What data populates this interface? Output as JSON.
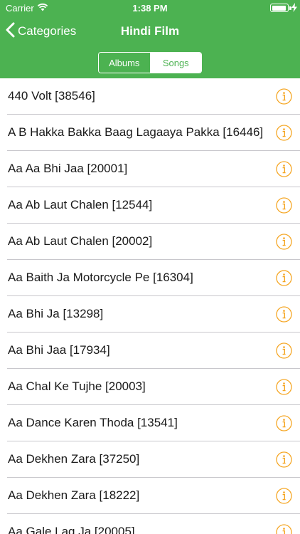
{
  "status_bar": {
    "carrier": "Carrier",
    "time": "1:38 PM",
    "wifi_icon": "wifi-icon",
    "battery_icon": "battery-icon",
    "charging_icon": "charging-bolt-icon"
  },
  "nav": {
    "back_label": "Categories",
    "title": "Hindi Film"
  },
  "segments": {
    "albums_label": "Albums",
    "songs_label": "Songs",
    "selected": "Songs"
  },
  "colors": {
    "accent": "#4cb251",
    "info_icon": "#f5a623",
    "separator": "#c8c7cc"
  },
  "songs": [
    {
      "title": "440 Volt [38546]"
    },
    {
      "title": "A B Hakka Bakka Baag Lagaaya Pakka [16446]"
    },
    {
      "title": "Aa Aa Bhi Jaa [20001]"
    },
    {
      "title": "Aa Ab Laut Chalen [12544]"
    },
    {
      "title": "Aa Ab Laut Chalen [20002]"
    },
    {
      "title": "Aa Baith Ja Motorcycle Pe [16304]"
    },
    {
      "title": "Aa Bhi Ja [13298]"
    },
    {
      "title": "Aa Bhi Jaa [17934]"
    },
    {
      "title": "Aa Chal Ke Tujhe [20003]"
    },
    {
      "title": "Aa Dance Karen Thoda [13541]"
    },
    {
      "title": "Aa Dekhen Zara [37250]"
    },
    {
      "title": "Aa Dekhen Zara [18222]"
    },
    {
      "title": "Aa Gale Lag Ja [20005]"
    }
  ]
}
